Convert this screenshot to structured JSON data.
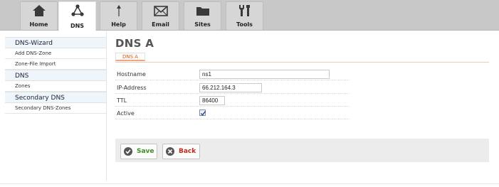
{
  "nav": {
    "tabs": [
      {
        "label": "Home",
        "icon": "home-icon"
      },
      {
        "label": "DNS",
        "icon": "network-icon"
      },
      {
        "label": "Help",
        "icon": "pin-icon"
      },
      {
        "label": "Email",
        "icon": "envelope-icon"
      },
      {
        "label": "Sites",
        "icon": "folder-icon"
      },
      {
        "label": "Tools",
        "icon": "tools-icon"
      }
    ],
    "active": "DNS"
  },
  "sidebar": {
    "sections": [
      {
        "heading": "DNS-Wizard",
        "items": [
          "Add DNS-Zone",
          "Zone-File Import"
        ]
      },
      {
        "heading": "DNS",
        "items": [
          "Zones"
        ]
      },
      {
        "heading": "Secondary DNS",
        "items": [
          "Secondary DNS-Zones"
        ]
      }
    ]
  },
  "main": {
    "title": "DNS A",
    "subtab": "DNS A",
    "form": {
      "hostname_label": "Hostname",
      "hostname_value": "ns1",
      "ip_label": "IP-Address",
      "ip_value": "66.212.164.3",
      "ttl_label": "TTL",
      "ttl_value": "86400",
      "active_label": "Active",
      "active_checked": true
    },
    "buttons": {
      "save_label": "Save",
      "back_label": "Back"
    }
  },
  "colors": {
    "accent": "#e35b17",
    "save": "#3c8d22",
    "back": "#c12a1c"
  }
}
